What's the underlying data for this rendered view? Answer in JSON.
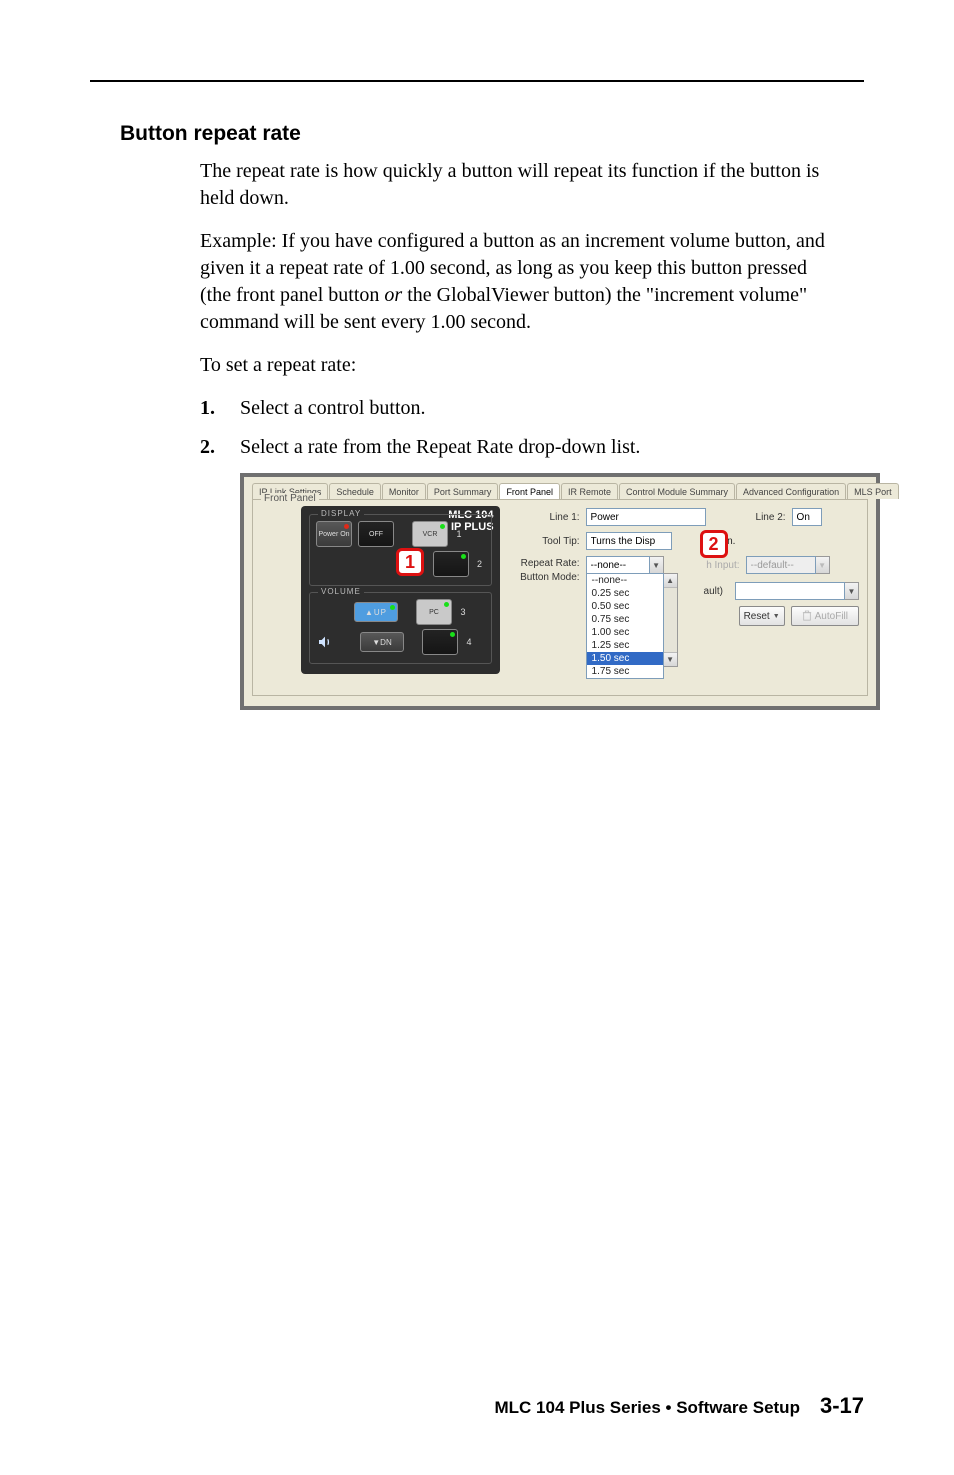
{
  "section_title": "Button repeat rate",
  "para1": "The repeat rate is how quickly a button will repeat its function if the button is held down.",
  "para2_pre": "Example: If you have configured a button as an increment volume button, and given it a repeat rate of 1.00 second, as long as you keep this button pressed (the front panel button ",
  "para2_italic": "or",
  "para2_post": " the GlobalViewer button) the \"increment volume\" command will be sent every 1.00 second.",
  "para3": "To set a repeat rate:",
  "steps": [
    {
      "num": "1.",
      "text": "Select a control button."
    },
    {
      "num": "2.",
      "text": "Select a rate from the Repeat Rate drop-down list."
    }
  ],
  "figure": {
    "tabs": [
      "IP Link Settings",
      "Schedule",
      "Monitor",
      "Port Summary",
      "Front Panel",
      "IR Remote",
      "Control Module Summary",
      "Advanced Configuration",
      "MLS Port"
    ],
    "active_tab_index": 4,
    "panel_label": "Front Panel",
    "device": {
      "brand_line1": "MLC 104",
      "brand_line2": "IP PLUS",
      "display_label": "DISPLAY",
      "volume_label": "VOLUME",
      "power_on": "Power On",
      "off": "OFF",
      "vcr": "VCR",
      "pc": "PC",
      "volup": "UP",
      "voldn": "DN",
      "idx": [
        "1",
        "2",
        "3",
        "4"
      ]
    },
    "badges": {
      "one": "1",
      "two": "2"
    },
    "form": {
      "line1_label": "Line 1:",
      "line1_value": "Power",
      "line2_label": "Line 2:",
      "line2_value": "On",
      "tooltip_label": "Tool Tip:",
      "tooltip_value_left": "Turns the Disp",
      "tooltip_value_right": "on.",
      "repeat_label": "Repeat Rate:",
      "repeat_options": [
        "--none--",
        "--none--",
        "0.25 sec",
        "0.50 sec",
        "0.75 sec",
        "1.00 sec",
        "1.25 sec",
        "1.50 sec",
        "1.75 sec"
      ],
      "repeat_selected": "1.50 sec",
      "buttonmode_label": "Button Mode:",
      "switchinput_label": "h Input:",
      "switchinput_value": "--default--",
      "ault_suffix": "ault)",
      "reset_label": "Reset",
      "autofill_label": "AutoFill"
    }
  },
  "footer": {
    "text": "MLC 104 Plus Series • Software Setup",
    "page": "3-17"
  }
}
